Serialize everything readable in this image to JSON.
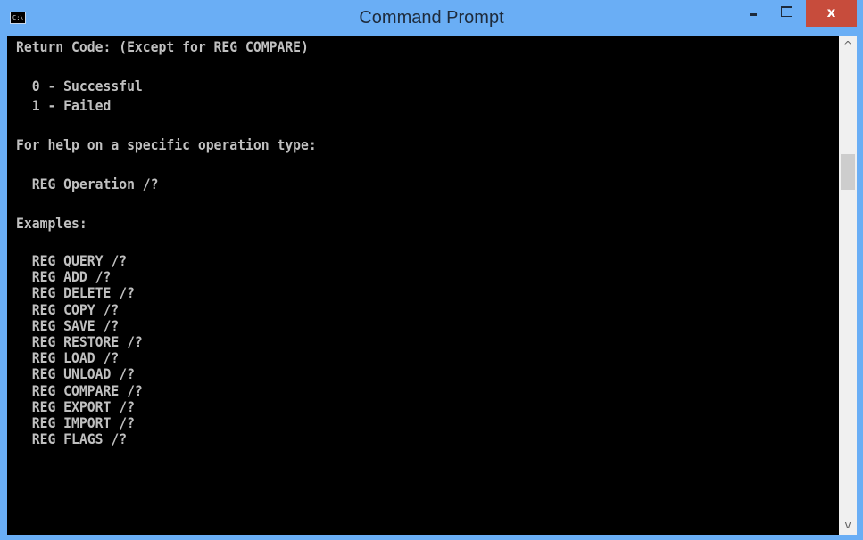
{
  "window": {
    "title": "Command Prompt",
    "icon_text": "C:\\",
    "icon": "console-icon",
    "controls": {
      "minimize_icon": "minimize-icon",
      "maximize_icon": "maximize-icon",
      "close_icon": "close-icon",
      "minimize_label": "–",
      "maximize_label": "□",
      "close_label": "x"
    },
    "colors": {
      "titlebar": "#6aaef5",
      "close_button": "#c74c3c",
      "console_background": "#000000",
      "console_text": "#c0c0c0"
    }
  },
  "console": {
    "lines": [
      "Return Code: (Except for REG COMPARE)",
      "",
      "  0 - Successful",
      "  1 - Failed",
      "",
      "For help on a specific operation type:",
      "",
      "  REG Operation /?",
      "",
      "Examples:",
      "",
      "  REG QUERY /?",
      "  REG ADD /?",
      "  REG DELETE /?",
      "  REG COPY /?",
      "  REG SAVE /?",
      "  REG RESTORE /?",
      "  REG LOAD /?",
      "  REG UNLOAD /?",
      "  REG COMPARE /?",
      "  REG EXPORT /?",
      "  REG IMPORT /?",
      "  REG FLAGS /?"
    ]
  },
  "scrollbar": {
    "up_arrow": "^",
    "down_arrow": "v",
    "up_icon": "scroll-up-arrow-icon",
    "down_icon": "scroll-down-arrow-icon"
  }
}
